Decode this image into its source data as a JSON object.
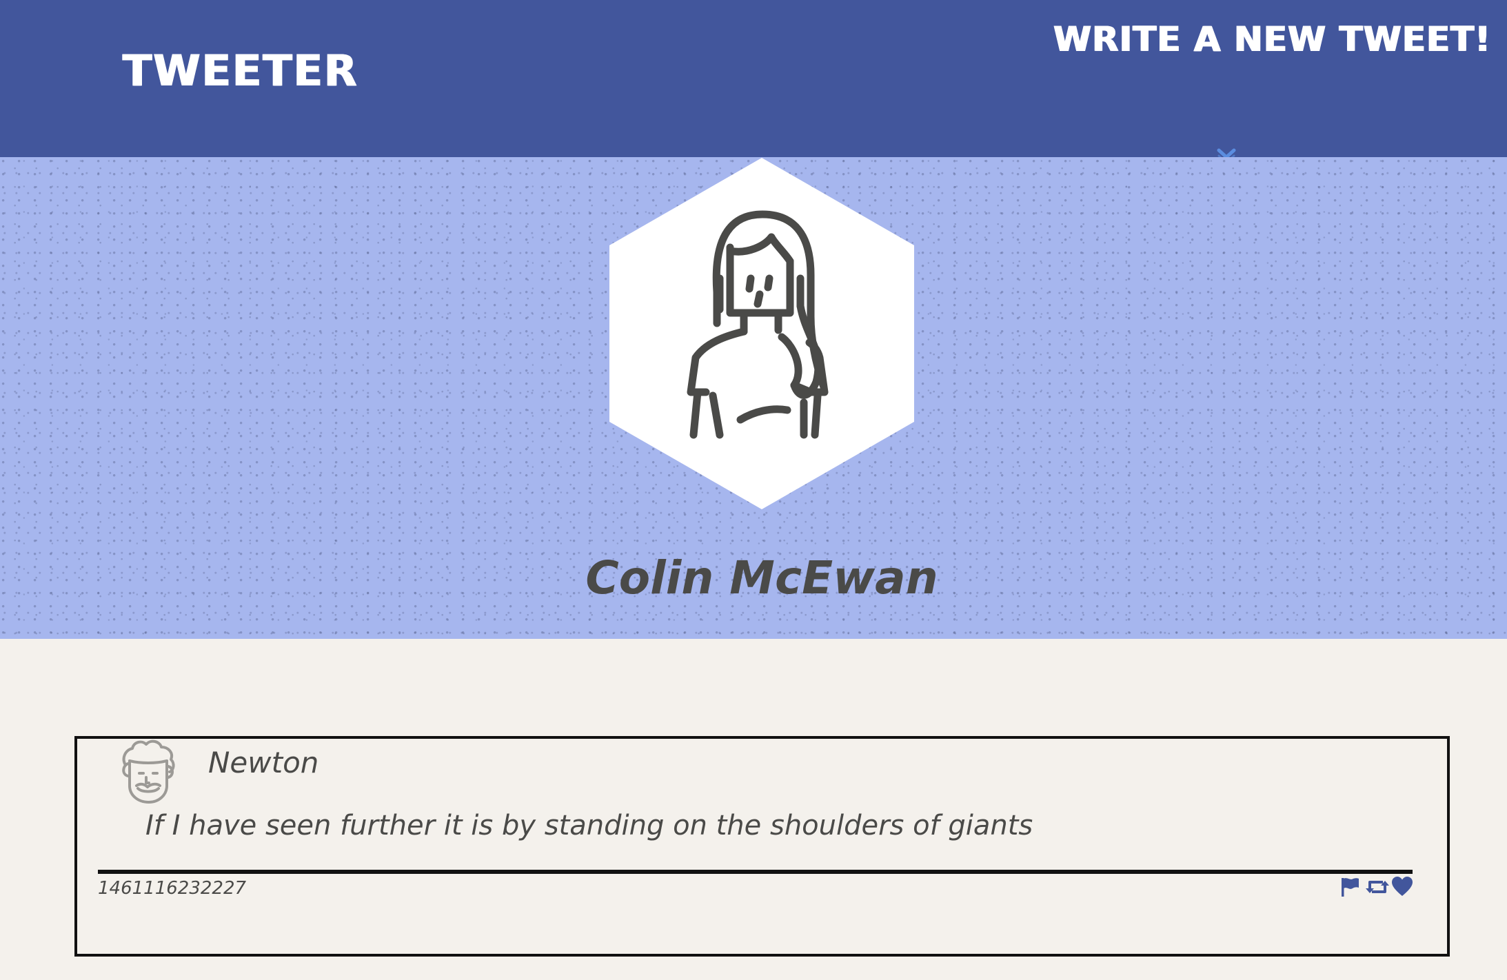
{
  "navbar": {
    "brand": "TWEETER",
    "compose_label": "WRITE A NEW TWEET!",
    "toggle_icon": "chevron-down-icon"
  },
  "profile": {
    "name": "Colin McEwan",
    "avatar_icon": "woman-avatar-icon"
  },
  "tweets": [
    {
      "author": "Newton",
      "avatar_icon": "man-avatar-icon",
      "text": "If I have seen further it is by standing on the shoulders of giants",
      "timestamp": "1461116232227",
      "actions": [
        "flag-icon",
        "retweet-icon",
        "heart-icon"
      ]
    }
  ],
  "colors": {
    "navbar_bg": "#42569c",
    "header_bg": "#a6b6ee",
    "page_bg": "#f4f1ec",
    "text": "#4a4a48",
    "accent": "#42569c",
    "toggle": "#5b8de0"
  }
}
